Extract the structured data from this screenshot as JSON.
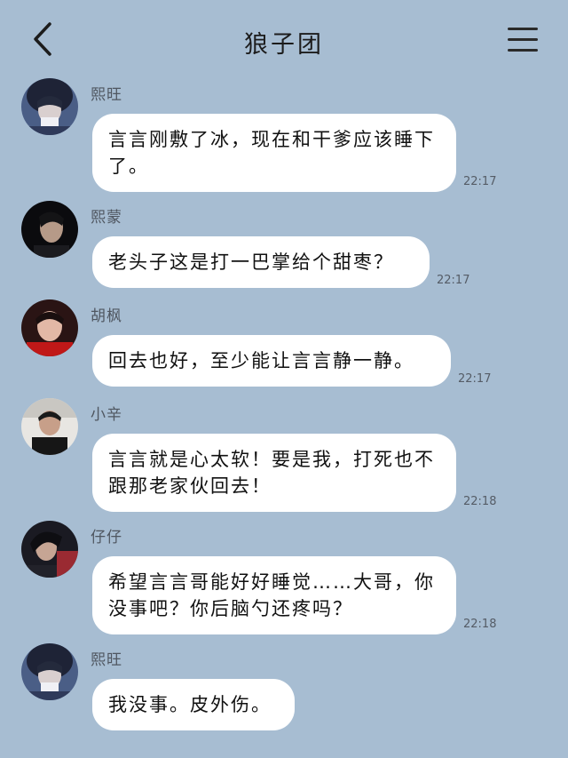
{
  "header": {
    "title": "狼子团"
  },
  "messages": [
    {
      "sender": "熙旺",
      "text": "言言刚敷了冰，现在和干爹应该睡下了。",
      "time": "22:17"
    },
    {
      "sender": "熙蒙",
      "text": "老头子这是打一巴掌给个甜枣？",
      "time": "22:17"
    },
    {
      "sender": "胡枫",
      "text": "回去也好，至少能让言言静一静。",
      "time": "22:17"
    },
    {
      "sender": "小辛",
      "text": "言言就是心太软！要是我，打死也不跟那老家伙回去！",
      "time": "22:18"
    },
    {
      "sender": "仔仔",
      "text": "希望言言哥能好好睡觉……大哥，你没事吧？你后脑勺还疼吗？",
      "time": "22:18"
    },
    {
      "sender": "熙旺",
      "text": "我没事。皮外伤。",
      "time": ""
    }
  ],
  "icons": {
    "back": "chevron-left-icon",
    "menu": "hamburger-menu-icon"
  },
  "colors": {
    "background": "#a7bdd2",
    "bubble": "#ffffff"
  }
}
